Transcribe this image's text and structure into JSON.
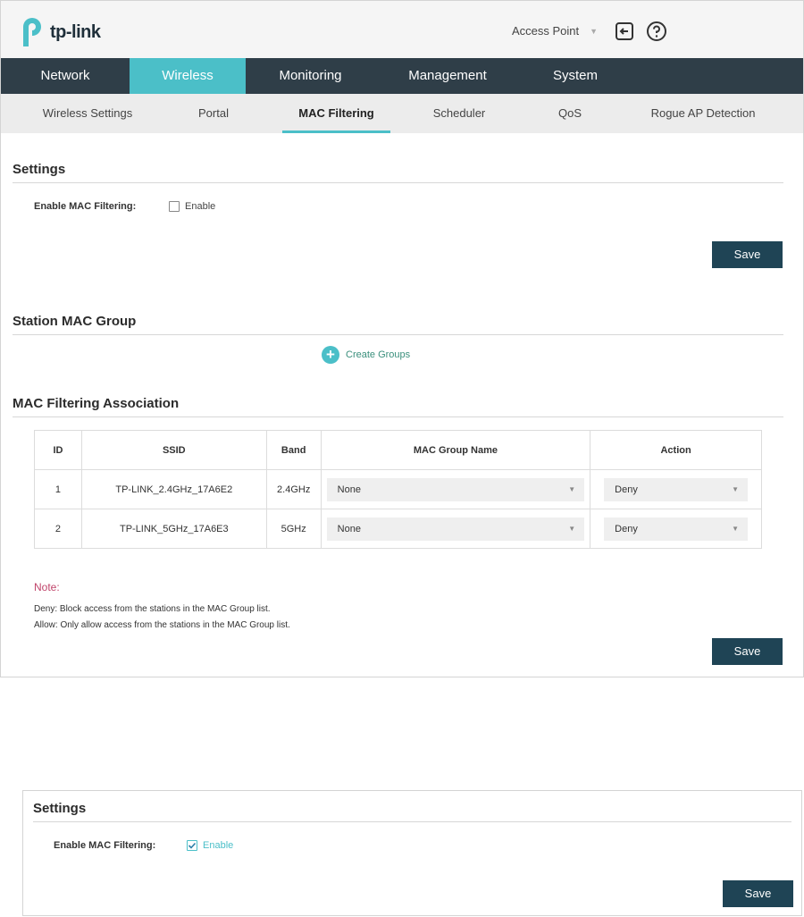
{
  "header": {
    "logo_text": "tp-link",
    "mode_select": "Access Point",
    "brand_color": "#4bbfc8",
    "icons": [
      "logout-icon",
      "help-icon"
    ]
  },
  "nav": {
    "tabs": [
      {
        "label": "Network"
      },
      {
        "label": "Wireless",
        "active": true
      },
      {
        "label": "Monitoring"
      },
      {
        "label": "Management"
      },
      {
        "label": "System"
      }
    ]
  },
  "subnav": {
    "tabs": [
      {
        "label": "Wireless Settings"
      },
      {
        "label": "Portal"
      },
      {
        "label": "MAC Filtering",
        "active": true
      },
      {
        "label": "Scheduler"
      },
      {
        "label": "QoS"
      },
      {
        "label": "Rogue AP Detection"
      }
    ]
  },
  "settings": {
    "title": "Settings",
    "field_label": "Enable MAC Filtering:",
    "checkbox_label": "Enable",
    "checked": false,
    "save_label": "Save"
  },
  "station_group": {
    "title": "Station MAC Group",
    "create_label": "Create Groups"
  },
  "association": {
    "title": "MAC Filtering Association",
    "columns": [
      "ID",
      "SSID",
      "Band",
      "MAC Group Name",
      "Action"
    ],
    "rows": [
      {
        "id": "1",
        "ssid": "TP-LINK_2.4GHz_17A6E2",
        "band": "2.4GHz",
        "group": "None",
        "action": "Deny"
      },
      {
        "id": "2",
        "ssid": "TP-LINK_5GHz_17A6E3",
        "band": "5GHz",
        "group": "None",
        "action": "Deny"
      }
    ]
  },
  "note": {
    "title": "Note:",
    "lines": [
      "Deny: Block access from the stations in the MAC Group list.",
      "Allow: Only allow access from the stations in the MAC Group list."
    ],
    "color": "#c0446a"
  },
  "bottom_save_label": "Save",
  "settings_enabled": {
    "title": "Settings",
    "field_label": "Enable MAC Filtering:",
    "checkbox_label": "Enable",
    "checked": true,
    "save_label": "Save"
  }
}
